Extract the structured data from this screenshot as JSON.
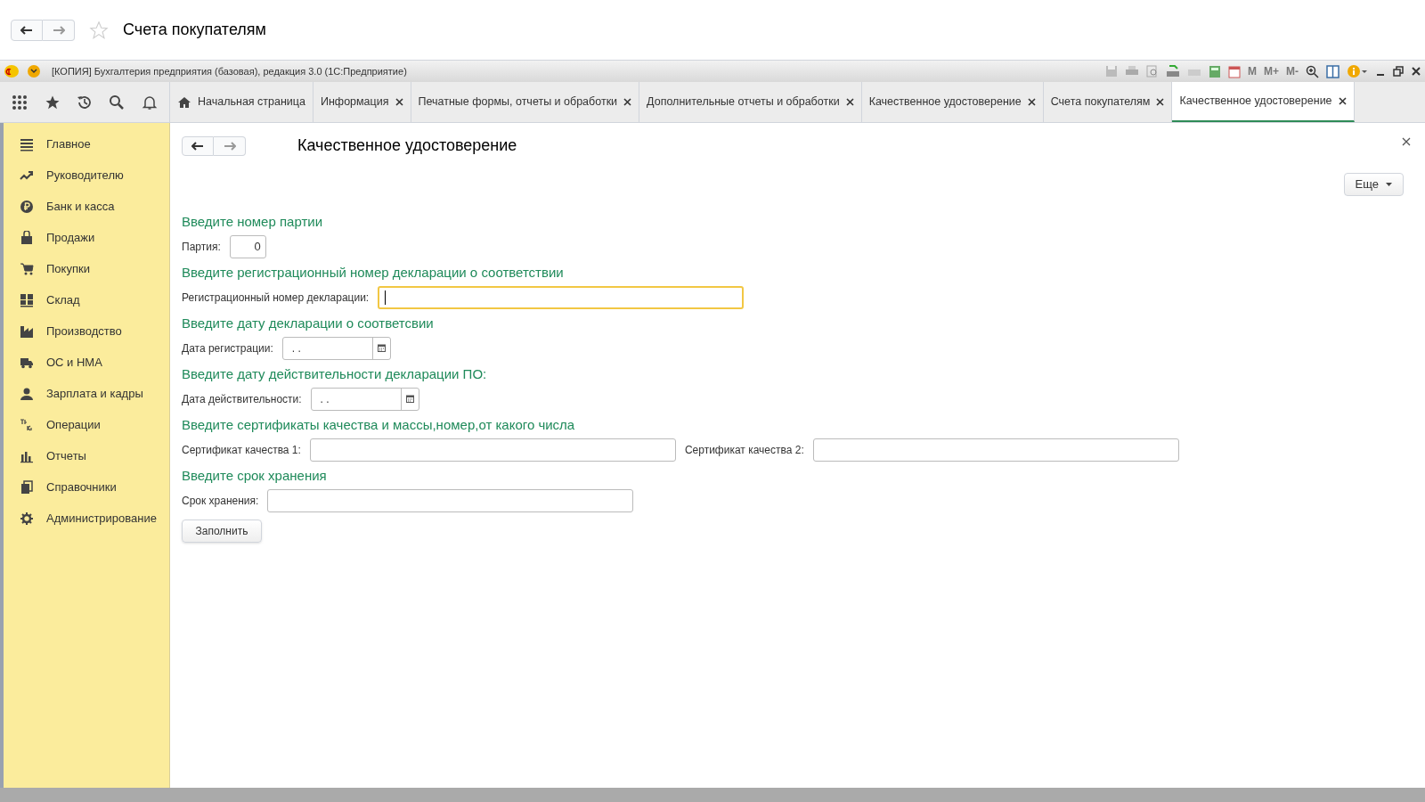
{
  "browser": {
    "title": "Счета покупателям"
  },
  "window": {
    "title": "[КОПИЯ] Бухгалтерия предприятия (базовая), редакция 3.0  (1С:Предприятие)",
    "memory_buttons": [
      "M",
      "M+",
      "M-"
    ]
  },
  "tabs": [
    {
      "label": "Начальная страница",
      "kind": "home",
      "selected": false
    },
    {
      "label": "Информация",
      "kind": "closable",
      "selected": false
    },
    {
      "label": "Печатные формы, отчеты и обработки",
      "kind": "closable",
      "selected": false
    },
    {
      "label": "Дополнительные отчеты и обработки",
      "kind": "closable",
      "selected": false
    },
    {
      "label": "Качественное удостоверение",
      "kind": "closable",
      "selected": false
    },
    {
      "label": "Счета покупателям",
      "kind": "closable",
      "selected": false
    },
    {
      "label": "Качественное удостоверение",
      "kind": "closable",
      "selected": true
    }
  ],
  "sidebar": {
    "items": [
      {
        "label": "Главное"
      },
      {
        "label": "Руководителю"
      },
      {
        "label": "Банк и касса"
      },
      {
        "label": "Продажи"
      },
      {
        "label": "Покупки"
      },
      {
        "label": "Склад"
      },
      {
        "label": "Производство"
      },
      {
        "label": "ОС и НМА"
      },
      {
        "label": "Зарплата и кадры"
      },
      {
        "label": "Операции"
      },
      {
        "label": "Отчеты"
      },
      {
        "label": "Справочники"
      },
      {
        "label": "Администрирование"
      }
    ]
  },
  "form": {
    "title": "Качественное удостоверение",
    "more_button": "Еще",
    "sections": [
      {
        "heading": "Введите номер партии",
        "fields": [
          {
            "kind": "number",
            "label": "Партия:",
            "value": "0",
            "focused": false
          }
        ]
      },
      {
        "heading": "Введите регистрационный номер декларации о соответствии",
        "fields": [
          {
            "kind": "text",
            "label": "Регистрационный номер декларации:",
            "focused": true
          }
        ]
      },
      {
        "heading": "Введите дату декларации о соответсвии",
        "fields": [
          {
            "kind": "date",
            "label": "Дата регистрации:",
            "value": ". .",
            "focused": false
          }
        ]
      },
      {
        "heading": "Введите дату действительности декларации ПО:",
        "fields": [
          {
            "kind": "date",
            "label": "Дата действительности:",
            "value": ". .",
            "focused": false
          }
        ]
      },
      {
        "heading": "Введите сертификаты качества и массы,номер,от какого числа",
        "fields": [
          {
            "kind": "text",
            "label": "Сертификат качества 1:",
            "focused": false
          },
          {
            "kind": "text",
            "label": "Сертификат качества 2:",
            "focused": false
          }
        ]
      },
      {
        "heading": "Введите срок хранения",
        "fields": [
          {
            "kind": "text",
            "label": "Срок хранения:",
            "focused": false
          }
        ]
      }
    ],
    "fill_button": "Заполнить"
  }
}
